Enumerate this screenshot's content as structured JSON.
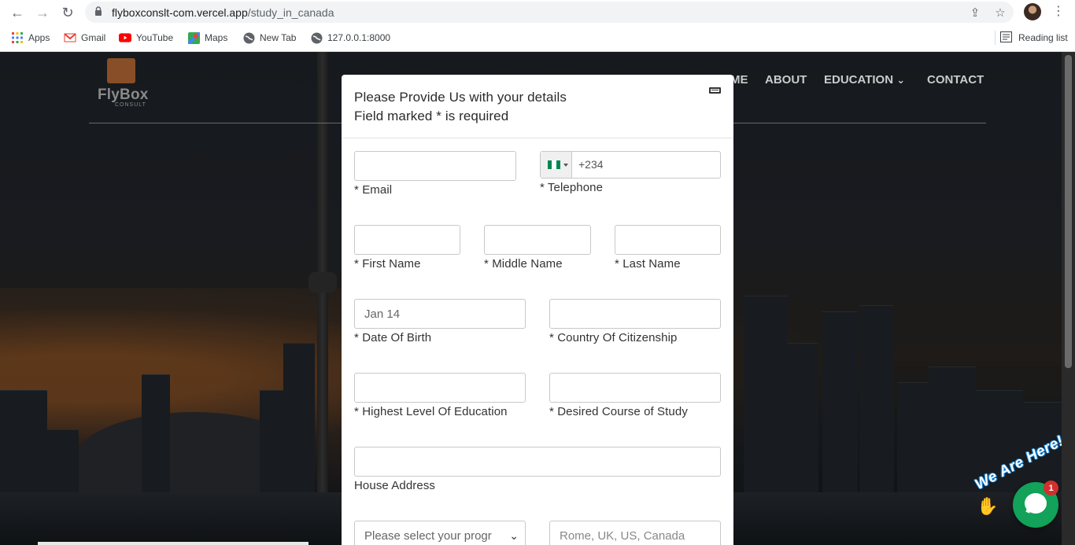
{
  "browser": {
    "url_host": "flyboxconslt-com.vercel.app",
    "url_path": "/study_in_canada",
    "bookmarks": [
      "Apps",
      "Gmail",
      "YouTube",
      "Maps",
      "New Tab",
      "127.0.0.1:8000"
    ],
    "reading_list": "Reading list"
  },
  "site": {
    "logo_text": "FlyBox",
    "logo_sub": "CONSULT",
    "nav": {
      "home_partial": "ME",
      "about": "ABOUT",
      "education": "EDUCATION",
      "education_caret": "⌄",
      "contact": "CONTACT"
    }
  },
  "modal": {
    "title_line1": "Please Provide Us with your details",
    "title_line2": "Field marked * is required",
    "fields": {
      "email_label": "* Email",
      "telephone_label": "* Telephone",
      "telephone_dial_code": "+234",
      "first_name_label": "* First Name",
      "middle_name_label": "* Middle Name",
      "last_name_label": "* Last Name",
      "dob_value": "Jan 14",
      "dob_label": "* Date Of Birth",
      "citizenship_label": "* Country Of Citizenship",
      "education_label": "* Highest Level Of Education",
      "course_label": "* Desired Course of Study",
      "address_label": "House Address",
      "program_select": "Please select your progr",
      "country_placeholder": "Rome, UK, US, Canada"
    }
  },
  "chat": {
    "banner": "We Are Here!",
    "badge": "1"
  },
  "colors": {
    "flag_green": "#008751",
    "chat_green": "#12a259",
    "badge_red": "#d32f2f"
  }
}
